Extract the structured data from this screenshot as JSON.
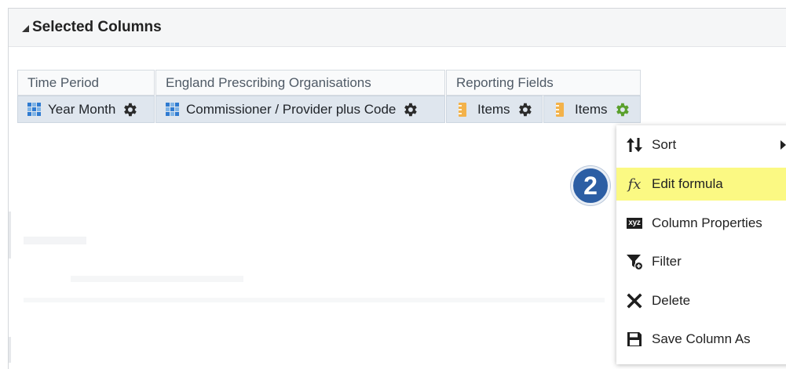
{
  "panel": {
    "title": "Selected Columns"
  },
  "columns": {
    "groups": [
      {
        "label": "Time Period"
      },
      {
        "label": "England Prescribing Organisations"
      },
      {
        "label": "Reporting Fields"
      }
    ],
    "items": [
      {
        "label": "Year Month",
        "icon": "attribute-grid-icon"
      },
      {
        "label": "Commissioner / Provider plus Code",
        "icon": "attribute-grid-icon"
      },
      {
        "label": "Items",
        "icon": "measure-ruler-icon"
      },
      {
        "label": "Items",
        "icon": "measure-ruler-icon",
        "active": true
      }
    ]
  },
  "context_menu": {
    "items": [
      {
        "label": "Sort",
        "icon": "sort-arrows-icon",
        "has_submenu": true
      },
      {
        "label": "Edit formula",
        "icon": "fx-formula-icon",
        "highlighted": true
      },
      {
        "label": "Column Properties",
        "icon": "xyz-properties-icon"
      },
      {
        "label": "Filter",
        "icon": "filter-funnel-icon"
      },
      {
        "label": "Delete",
        "icon": "delete-x-icon"
      },
      {
        "label": "Save Column As",
        "icon": "save-floppy-icon"
      }
    ]
  },
  "step_badge": {
    "number": "2"
  },
  "icon_glyphs": {
    "fx": "fx",
    "xyz": "xyz"
  },
  "colors": {
    "highlight": "#fbf983",
    "badge": "#2c5ea4",
    "active_gear": "#5aa02c",
    "gear": "#2b2b2b",
    "attribute_icon": "#4a8fd0",
    "measure_icon": "#f3b24a"
  }
}
